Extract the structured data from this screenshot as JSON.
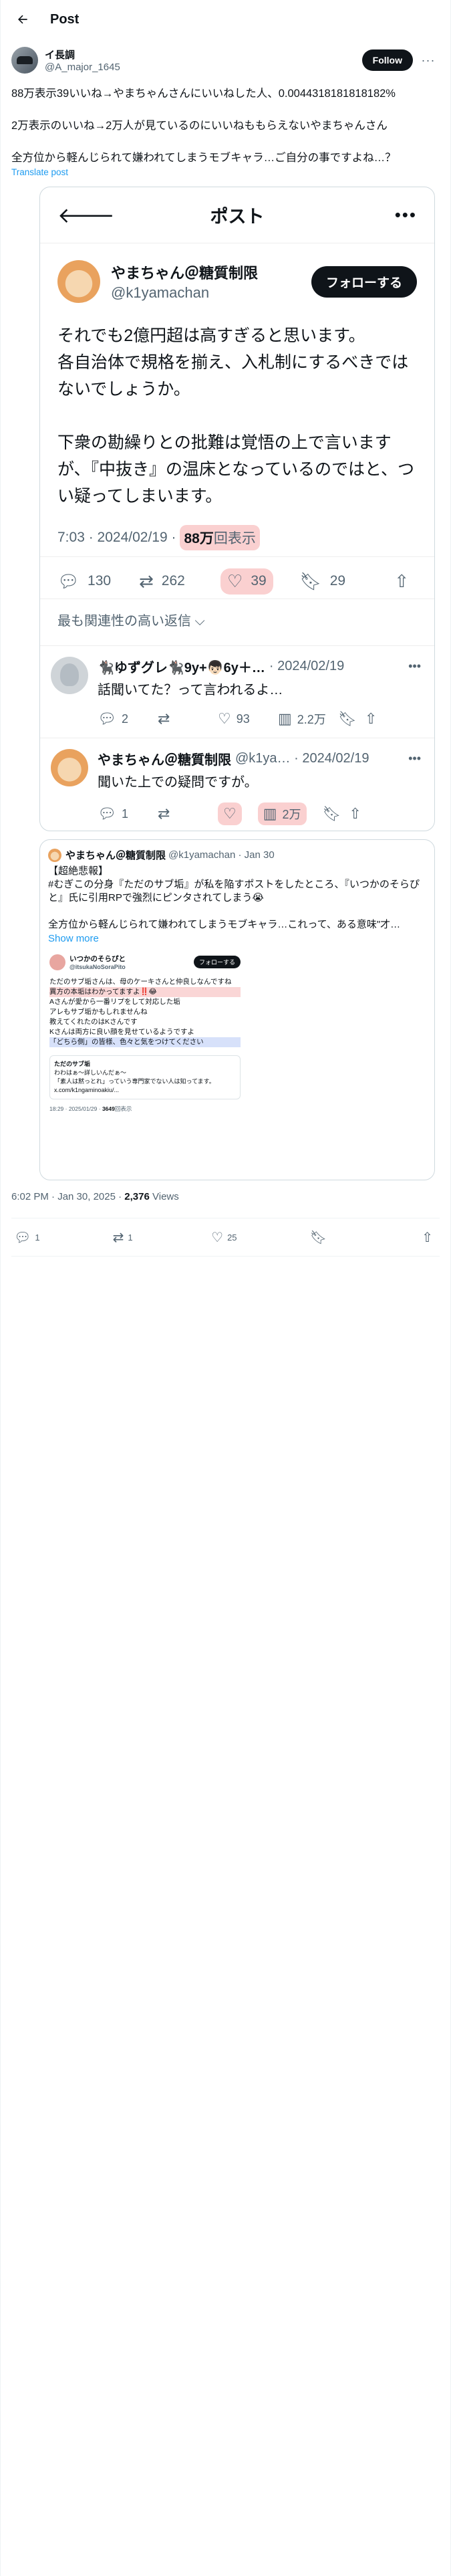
{
  "header": {
    "title": "Post"
  },
  "author": {
    "name": "イ長調",
    "handle": "@A_major_1645",
    "follow_label": "Follow",
    "more": "···"
  },
  "post": {
    "text": "88万表示39いいね→やまちゃんさんにいいねした人、0.0044318181818182%\n\n2万表示のいいね→2万人が見ているのにいいねももらえないやまちゃんさん\n\n全方位から軽んじられて嫌われてしまうモブキャラ…ご自分の事ですよね…？",
    "translate": "Translate post"
  },
  "embed": {
    "header_title": "ポスト",
    "back": "🡐",
    "more": "•••",
    "author_name": "やまちゃん＠糖質制限",
    "author_handle": "@k1yamachan",
    "follow_label": "フォローする",
    "text": "それでも2億円超は高すぎると思います。\n各自治体で規格を揃え、入札制にするべきではないでしょうか。\n\n下衆の勘繰りとの批難は覚悟の上で言いますが、『中抜き』の温床となっているのではと、つい疑ってしまいます。",
    "time": "7:03 · 2024/02/19 ·",
    "views_count": "88万",
    "views_unit": "回表示",
    "replies": "130",
    "reposts": "262",
    "likes": "39",
    "bookmarks": "29",
    "sort_label": "最も関連性の高い返信 ⌵",
    "reply1": {
      "name": "🐈‍⬛ゆずグレ🐈‍⬛9y+👦🏻6y＋…",
      "date": "· 2024/02/19",
      "text": "話聞いてた？って言われるよ…",
      "replies": "2",
      "reposts": "",
      "likes": "93",
      "views": "2.2万"
    },
    "reply2": {
      "name": "やまちゃん＠糖質制限",
      "handle": "@k1ya…",
      "date": "· 2024/02/19",
      "text": "聞いた上での疑問ですが。",
      "replies": "1",
      "reposts": "",
      "likes": "",
      "views": "2万"
    }
  },
  "quote": {
    "name": "やまちゃん＠糖質制限",
    "handle": "@k1yamachan · Jan 30",
    "text": "【超絶悲報】\n#むぎこの分身『ただのサブ垢』が私を陥すポストをしたところ、『いつかのそらぴと』氏に引用RPで強烈にピンタされてしまう😭\n\n全方位から軽んじられて嫌われてしまうモブキャラ…これって、ある意味\"才…",
    "show_more": "Show more",
    "image": {
      "name": "いつかのそらぴと",
      "handle": "@itsukaNoSoraPito",
      "follow": "フォローする",
      "lines": [
        "ただのサブ垢さんは、母のケーキさんと仲良しなんですね",
        "異方の本垢はわかってますよ‼️😂",
        "Aさんが愛から一番リプをして対応した垢",
        "アレもサブ垢かもしれませんね",
        "教えてくれたのはKさんです",
        "Kさんは両方に良い顔を見せているようですよ",
        "「どちら側」の皆様、色々と気をつけてください"
      ],
      "inner_name": "ただのサブ垢",
      "inner_text": "わわはぁ〜詳しいんだぁ〜\n「素人は黙っとれ」っていう専門家でない人は知ってます。x.com/k1ngaminoakiu/...",
      "foot_time": "18:29 · 2025/01/29 ·",
      "foot_views": "3649",
      "foot_unit": "回表示"
    }
  },
  "timestamp": {
    "time": "6:02 PM · Jan 30, 2025 ·",
    "views": "2,376",
    "views_label": "Views"
  },
  "actions": {
    "replies": "1",
    "reposts": "1",
    "likes": "25"
  }
}
